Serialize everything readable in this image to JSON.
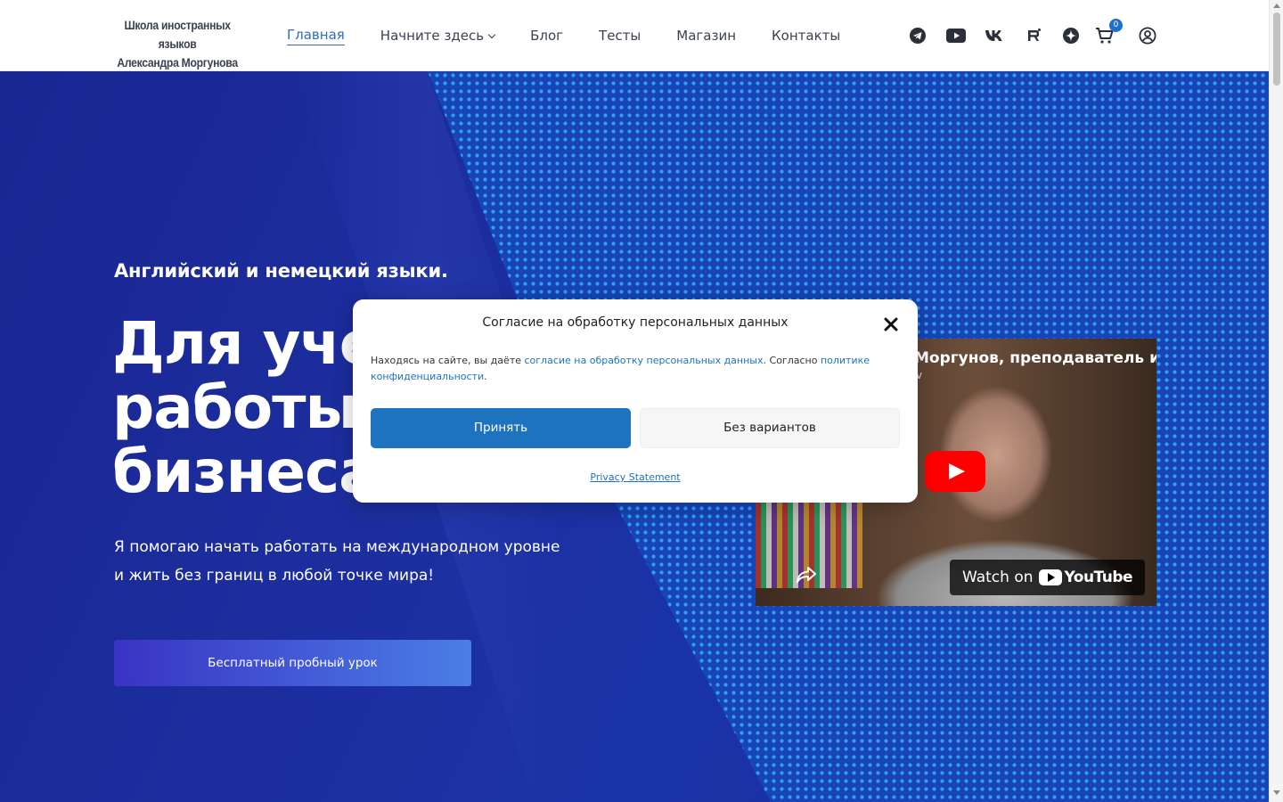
{
  "header": {
    "logo_line1": "Школа иностранных языков",
    "logo_line2": "Александра Моргунова",
    "nav": [
      {
        "label": "Главная",
        "active": true
      },
      {
        "label": "Начните здесь",
        "has_dropdown": true
      },
      {
        "label": "Блог"
      },
      {
        "label": "Тесты"
      },
      {
        "label": "Магазин"
      },
      {
        "label": "Контакты"
      }
    ],
    "icons": [
      "telegram-icon",
      "youtube-icon",
      "vk-icon",
      "rutube-icon",
      "dzen-icon",
      "cart-icon",
      "account-icon"
    ],
    "cart_count": "0"
  },
  "hero": {
    "subtitle": "Английский и немецкий языки.",
    "headline_line1": "Для учеб",
    "headline_line2": "работы и",
    "headline_line3": "бизнеса.",
    "lead_line1": "Я помогаю начать работать на международном уровне",
    "lead_line2": "и жить без границ в любой точке мира!",
    "cta_label": "Бесплатный пробный урок"
  },
  "video": {
    "title": "Моргунов, преподаватель и",
    "subtitle": "v",
    "watch_label": "Watch on",
    "youtube_label": "YouTube"
  },
  "consent_modal": {
    "title": "Согласие на обработку персональных данных",
    "text_before": "Находясь на сайте, вы даёте ",
    "link_consent": "согласие на обработку персональных данных",
    "text_middle": ". Согласно ",
    "link_policy": "политике конфиденциальности",
    "text_after": ".",
    "accept_label": "Принять",
    "deny_label": "Без вариантов",
    "privacy_label": "Privacy Statement"
  },
  "colors": {
    "accent": "#1e73be",
    "nav_active": "#2e6fb6",
    "hero_bg": "#1c2fa0",
    "dots": "#2fa6f0",
    "youtube_red": "#ff0000"
  }
}
